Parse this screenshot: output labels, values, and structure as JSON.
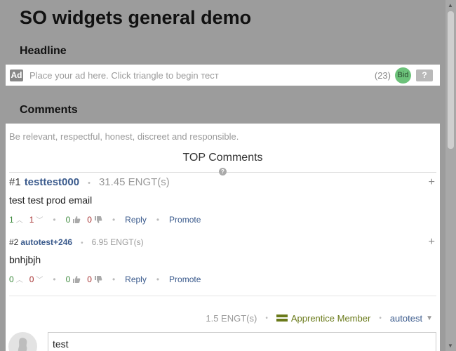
{
  "page_title": "SO widgets general demo",
  "headline": {
    "title": "Headline",
    "ad_badge": "Ad",
    "placeholder": "Place your ad here. Click triangle to begin тест",
    "count": "(23)",
    "bid_label": "Bid",
    "help_label": "?"
  },
  "comments": {
    "title": "Comments",
    "rules": "Be relevant, respectful, honest, discreet and responsible.",
    "top_title": "TOP Comments",
    "help_icon": "?",
    "separator": "•",
    "plus_label": "+",
    "reply_label": "Reply",
    "promote_label": "Promote",
    "items": [
      {
        "rank": "#1",
        "user": "testtest000",
        "engt": "31.45 ENGT(s)",
        "body": "test test prod email",
        "up": "1",
        "down": "1",
        "likes": "0",
        "dislikes": "0"
      },
      {
        "rank": "#2",
        "user": "autotest+246",
        "engt": "6.95 ENGT(s)",
        "body": "bnhjbjh",
        "up": "0",
        "down": "0",
        "likes": "0",
        "dislikes": "0"
      }
    ],
    "composer": {
      "engt": "1.5 ENGT(s)",
      "member": "Apprentice Member",
      "user": "autotest",
      "value": "test"
    }
  },
  "colors": {
    "background": "#9c9c9c",
    "link": "#3a5a8c",
    "upvote": "#3e8a3e",
    "downvote": "#a63232",
    "bid": "#6cc27a",
    "member": "#6a7a1a"
  },
  "icons": [
    "ad-icon",
    "bid-icon",
    "help-icon",
    "plus-icon",
    "chevron-up-icon",
    "chevron-down-icon",
    "thumbs-up-icon",
    "thumbs-down-icon",
    "member-badge-icon",
    "caret-down-icon",
    "avatar-icon"
  ]
}
